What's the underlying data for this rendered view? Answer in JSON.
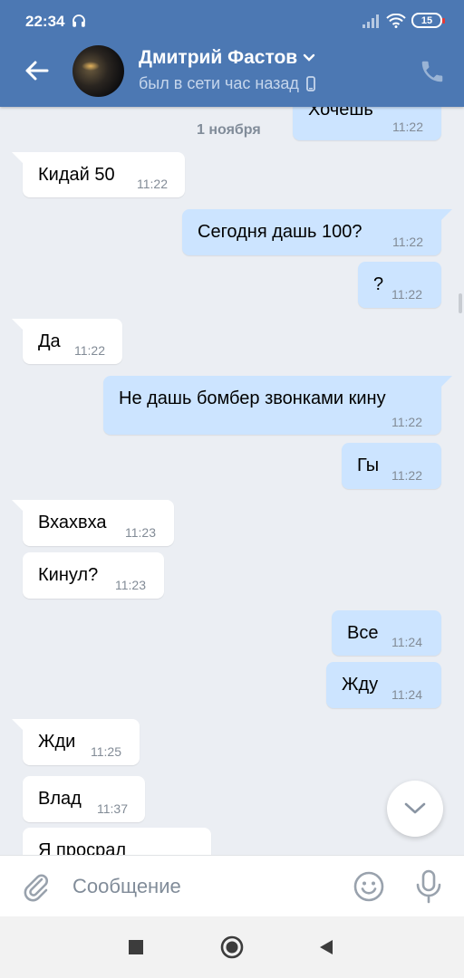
{
  "status_bar": {
    "time": "22:34",
    "battery": "15"
  },
  "header": {
    "contact_name": "Дмитрий Фастов",
    "contact_status": "был в сети час назад"
  },
  "chat": {
    "date_separator": "1 ноября",
    "messages": [
      {
        "dir": "out",
        "text": "Хочешь",
        "time": "11:22"
      },
      {
        "dir": "in",
        "text": "Кидай 50",
        "time": "11:22"
      },
      {
        "dir": "out",
        "text": "Сегодня дашь 100?",
        "time": "11:22"
      },
      {
        "dir": "out",
        "text": "?",
        "time": "11:22"
      },
      {
        "dir": "in",
        "text": "Да",
        "time": "11:22"
      },
      {
        "dir": "out",
        "text": "Не дашь бомбер звонками кину",
        "time": "11:22"
      },
      {
        "dir": "out",
        "text": "Гы",
        "time": "11:22"
      },
      {
        "dir": "in",
        "text": "Вхахвха",
        "time": "11:23"
      },
      {
        "dir": "in",
        "text": "Кинул?",
        "time": "11:23"
      },
      {
        "dir": "out",
        "text": "Все",
        "time": "11:24"
      },
      {
        "dir": "out",
        "text": "Жду",
        "time": "11:24"
      },
      {
        "dir": "in",
        "text": "Жди",
        "time": "11:25"
      },
      {
        "dir": "in",
        "text": "Влад",
        "time": "11:37"
      },
      {
        "dir": "in",
        "text": "Я просрал",
        "time": ""
      }
    ]
  },
  "composer": {
    "placeholder": "Сообщение"
  },
  "colors": {
    "header": "#4c78b3",
    "incoming": "#ffffff",
    "outgoing": "#cce4ff",
    "background": "#ebeef3"
  },
  "icons": [
    "headset-icon",
    "signal-icon",
    "wifi-icon",
    "battery-icon",
    "back-arrow-icon",
    "chevron-down-icon",
    "mobile-icon",
    "phone-icon",
    "chevron-down-icon",
    "paperclip-icon",
    "emoji-icon",
    "microphone-icon",
    "nav-recents-icon",
    "nav-home-icon",
    "nav-back-icon"
  ]
}
